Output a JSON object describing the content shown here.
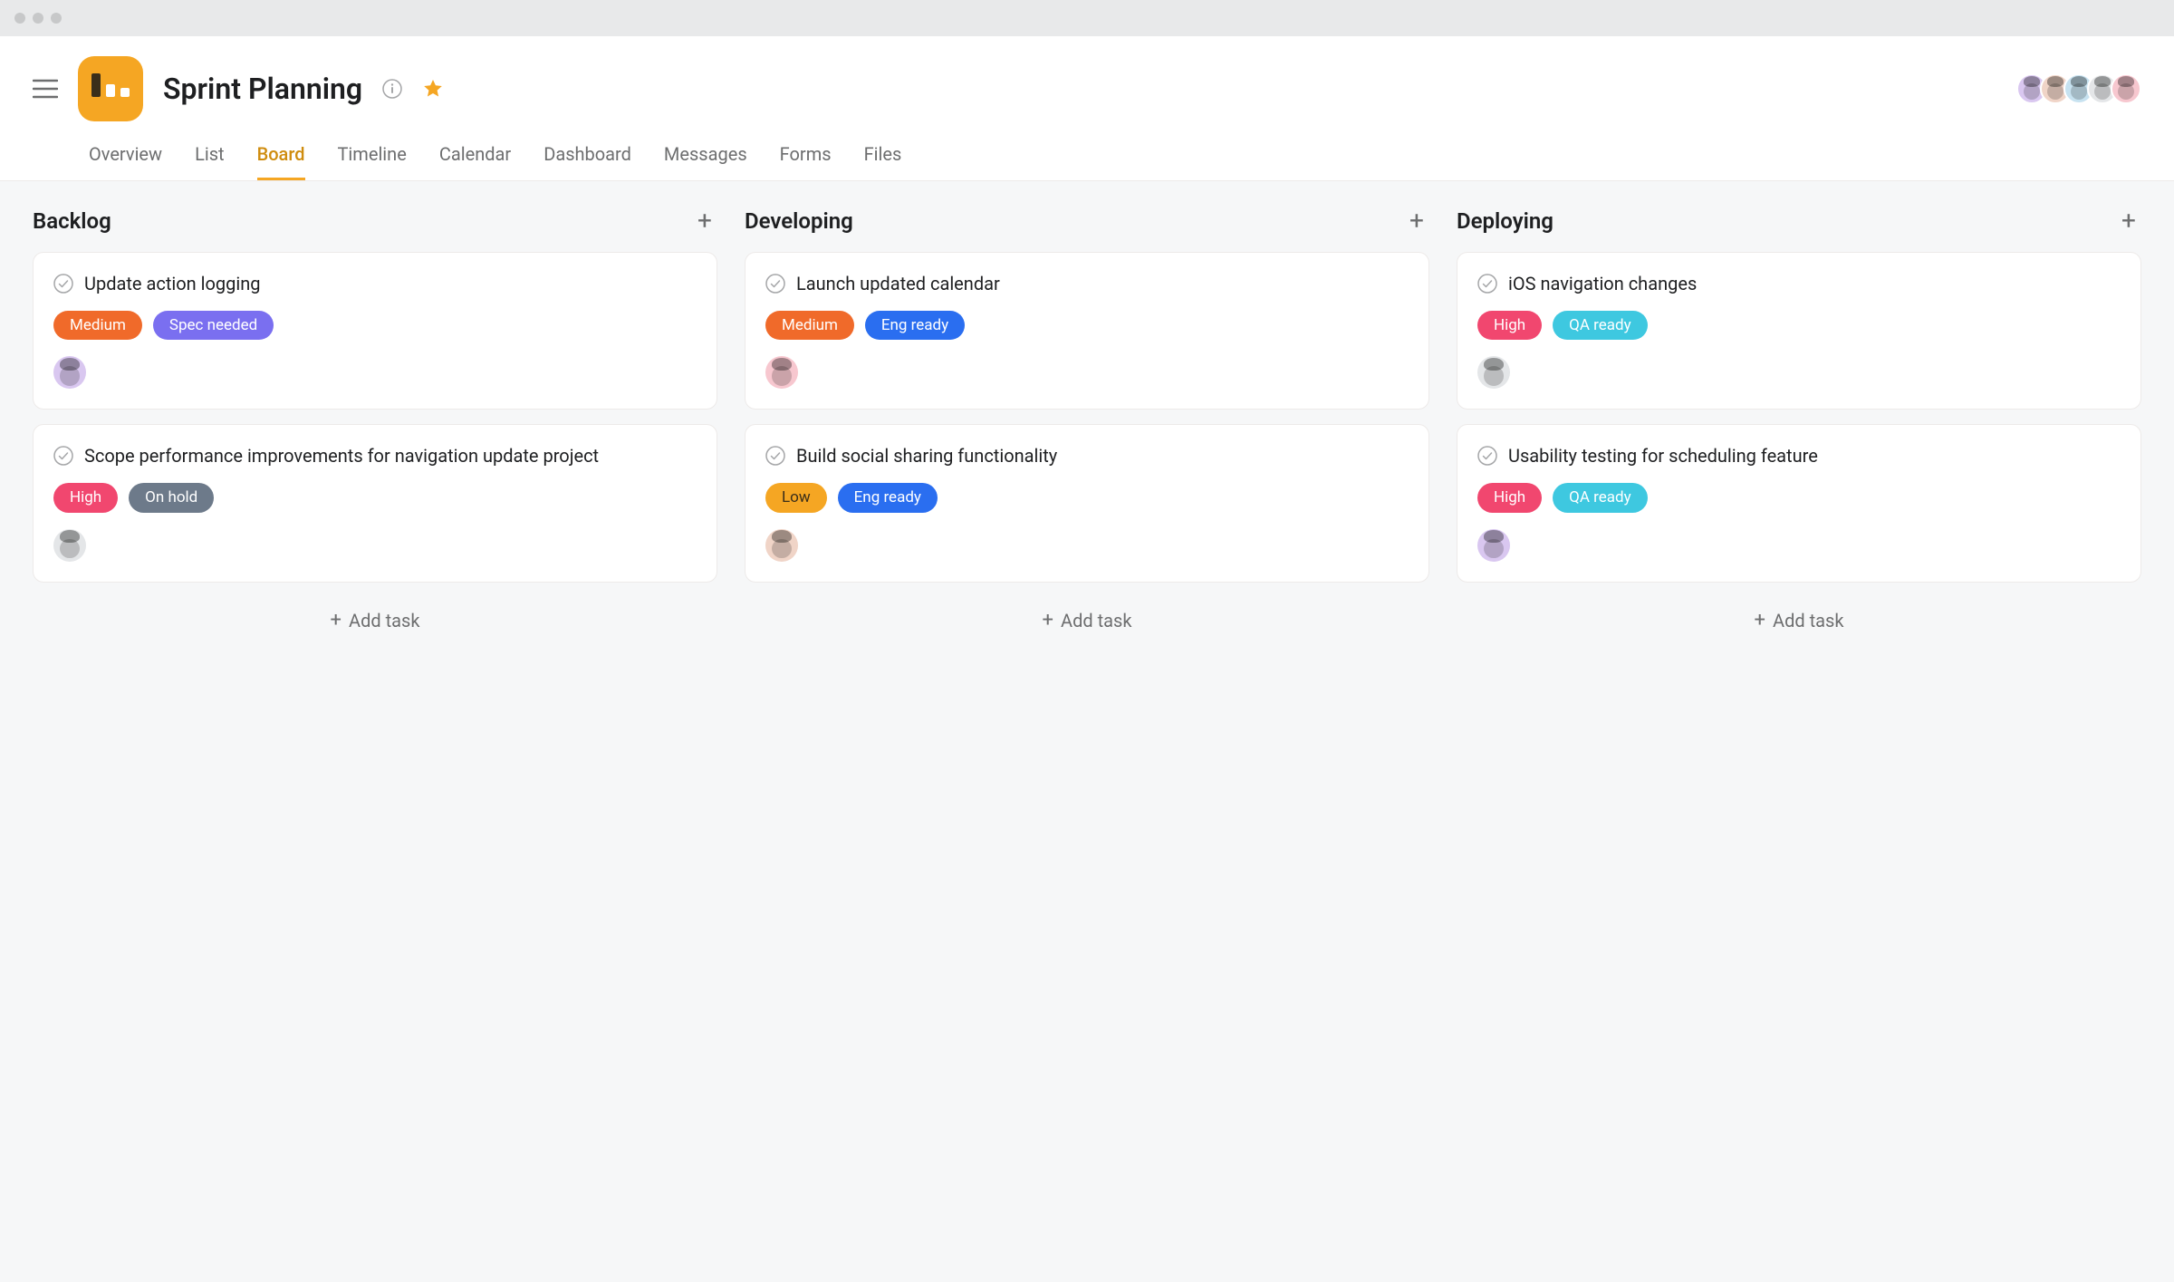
{
  "project": {
    "title": "Sprint Planning",
    "starred": true
  },
  "tabs": [
    {
      "label": "Overview",
      "active": false
    },
    {
      "label": "List",
      "active": false
    },
    {
      "label": "Board",
      "active": true
    },
    {
      "label": "Timeline",
      "active": false
    },
    {
      "label": "Calendar",
      "active": false
    },
    {
      "label": "Dashboard",
      "active": false
    },
    {
      "label": "Messages",
      "active": false
    },
    {
      "label": "Forms",
      "active": false
    },
    {
      "label": "Files",
      "active": false
    }
  ],
  "header_members": [
    {
      "bg": "#d9c7f0"
    },
    {
      "bg": "#f0d4c7"
    },
    {
      "bg": "#c7e2f0"
    },
    {
      "bg": "#e4e6e8"
    },
    {
      "bg": "#f7c7cf"
    }
  ],
  "tag_colors": {
    "Medium": "#f06a2a",
    "Spec needed": "#7a6ff0",
    "High": "#f1476f",
    "On hold": "#6d7a8a",
    "Eng ready": "#2a6ef0",
    "Low": "#f5a623",
    "QA ready": "#3ec8e0"
  },
  "add_task_label": "Add task",
  "columns": [
    {
      "title": "Backlog",
      "cards": [
        {
          "title": "Update action logging",
          "tags": [
            "Medium",
            "Spec needed"
          ],
          "assignee": {
            "bg": "#d9c7f0"
          }
        },
        {
          "title": "Scope performance improvements for navigation update project",
          "tags": [
            "High",
            "On hold"
          ],
          "assignee": {
            "bg": "#e4e6e8"
          }
        }
      ]
    },
    {
      "title": "Developing",
      "cards": [
        {
          "title": "Launch updated calendar",
          "tags": [
            "Medium",
            "Eng ready"
          ],
          "assignee": {
            "bg": "#f7c7cf"
          }
        },
        {
          "title": "Build social sharing functionality",
          "tags": [
            "Low",
            "Eng ready"
          ],
          "assignee": {
            "bg": "#f0d4c7"
          }
        }
      ]
    },
    {
      "title": "Deploying",
      "cards": [
        {
          "title": "iOS navigation changes",
          "tags": [
            "High",
            "QA ready"
          ],
          "assignee": {
            "bg": "#e4e6e8"
          }
        },
        {
          "title": "Usability testing for scheduling feature",
          "tags": [
            "High",
            "QA ready"
          ],
          "assignee": {
            "bg": "#d9c7f0"
          }
        }
      ]
    }
  ]
}
